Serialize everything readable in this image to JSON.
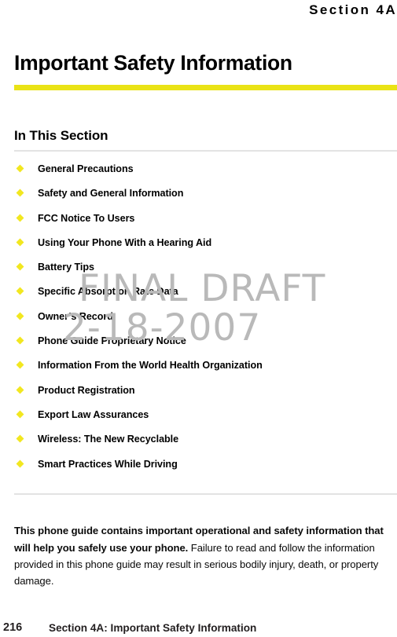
{
  "running_head": "Section 4A",
  "chapter_title": "Important Safety Information",
  "section": {
    "heading": "In This Section",
    "items": [
      {
        "label": "General Precautions"
      },
      {
        "label": "Safety and General Information"
      },
      {
        "label": "FCC Notice To Users"
      },
      {
        "label": "Using Your Phone With a Hearing Aid"
      },
      {
        "label": "Battery Tips"
      },
      {
        "label": "Specific Absorption Rate Data"
      },
      {
        "label": "Owner’s Record"
      },
      {
        "label": "Phone Guide Proprietary Notice"
      },
      {
        "label": "Information From the World Health Organization"
      },
      {
        "label": "Product Registration"
      },
      {
        "label": "Export Law Assurances"
      },
      {
        "label": "Wireless: The New Recyclable"
      },
      {
        "label": "Smart Practices While Driving"
      }
    ]
  },
  "body_note": {
    "lead": "This phone guide contains important operational and safety information that will help you safely use your phone.",
    "rest": " Failure to read and follow the information provided in this phone guide may result in serious bodily injury, death, or property damage."
  },
  "footer": {
    "page_number": "216",
    "title": "Section 4A: Important Safety Information"
  },
  "watermark": {
    "line1": "FINAL DRAFT",
    "line2": "2-18-2007"
  },
  "colors": {
    "accent_rule": "#eae316",
    "bullet": "#f2e720",
    "divider": "#e3e3e3",
    "watermark": "#b9b9b9",
    "text": "#000000"
  }
}
